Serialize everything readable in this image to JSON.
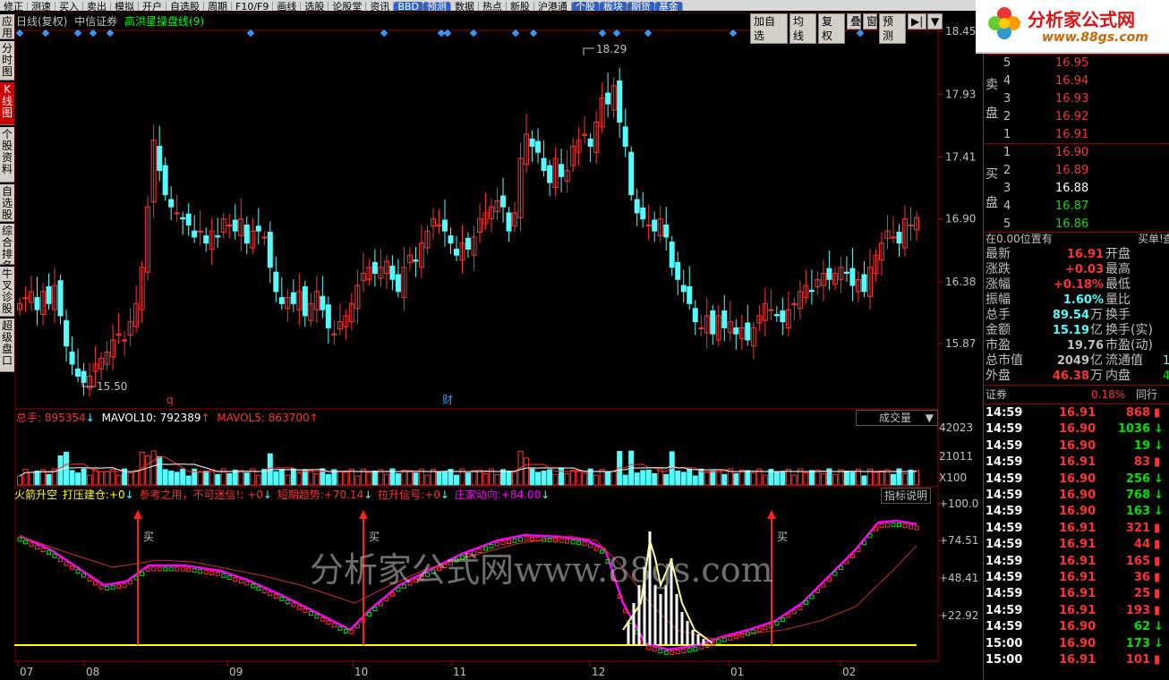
{
  "toolbar": {
    "items": [
      "修正",
      "测速",
      "买入",
      "卖出",
      "模拟",
      "开户",
      "自选股",
      "周期",
      "F10/F9",
      "画线",
      "选股",
      "论股堂",
      "资讯",
      "BBD",
      "预测",
      "数据",
      "热点",
      "新股",
      "沪港通",
      "个股",
      "板块",
      "期货",
      "基金"
    ]
  },
  "logo": {
    "name": "分析家公式网",
    "url": "www.88gs.com"
  },
  "left_tabs": [
    {
      "label": "应用"
    },
    {
      "label": "分时图"
    },
    {
      "label": "K线图"
    },
    {
      "label": "个股资料"
    },
    {
      "label": "自选股"
    },
    {
      "label": "综合排名"
    },
    {
      "label": "牛叉诊股"
    },
    {
      "label": "超级盘口"
    }
  ],
  "chart_header": {
    "period": "日线(复权)",
    "stock": "中信证券",
    "indicator": "高洪星操盘线(9)"
  },
  "chart_buttons": [
    "加自选",
    "均线",
    "复权",
    "叠",
    "窗",
    "预测"
  ],
  "price_axis": [
    "18.45",
    "17.93",
    "17.41",
    "16.90",
    "16.38",
    "15.87"
  ],
  "price_annotations": {
    "high": "18.29",
    "low": "15.50",
    "q_mark": "q",
    "cai_mark": "财"
  },
  "volume_header": {
    "total_label": "总手:",
    "total_value": "895354",
    "mavol10_label": "MAVOL10:",
    "mavol10_value": "792389",
    "mavol5_label": "MAVOL5:",
    "mavol5_value": "863700",
    "dropdown": "成交量"
  },
  "volume_axis": [
    "42023",
    "21011",
    "X100"
  ],
  "indicator_header": {
    "name": "火箭升空",
    "t1": "打压建仓:",
    "v1": "+0",
    "t2": "参考之用，不可迷信!",
    "v2": "+0",
    "t3": "短期趋势:",
    "v3": "+70.14",
    "t4": "拉升信号:",
    "v4": "+0",
    "t5": "庄家动向:",
    "v5": "+84.00",
    "button": "指标说明"
  },
  "indicator_axis": [
    "+100.0",
    "+74.51",
    "+48.41",
    "+22.92"
  ],
  "buy_label": "买",
  "watermark": "分析家公式网www.88gs.com",
  "date_axis": [
    "07",
    "08",
    "09",
    "10",
    "11",
    "12",
    "01",
    "02"
  ],
  "colors": {
    "up": "#ff3232",
    "down": "#54fcfc",
    "magenta": "#ff00ff",
    "yellow": "#ffff00",
    "green": "#00e000"
  },
  "order_book": {
    "sell_label": [
      "卖",
      "盘"
    ],
    "buy_label": [
      "买",
      "盘"
    ],
    "sell": [
      {
        "level": "5",
        "price": "16.95"
      },
      {
        "level": "4",
        "price": "16.94"
      },
      {
        "level": "3",
        "price": "16.93"
      },
      {
        "level": "2",
        "price": "16.92"
      },
      {
        "level": "1",
        "price": "16.91"
      }
    ],
    "buy": [
      {
        "level": "1",
        "price": "16.90"
      },
      {
        "level": "2",
        "price": "16.89"
      },
      {
        "level": "3",
        "price": "16.88"
      },
      {
        "level": "4",
        "price": "16.87"
      },
      {
        "level": "5",
        "price": "16.86"
      }
    ],
    "position_text": "在0.00位置有",
    "buy_single": "买单!",
    "buy_single_extra": "查"
  },
  "quotes": [
    {
      "l": "最新",
      "v": "16.91",
      "r": "开盘"
    },
    {
      "l": "涨跌",
      "v": "+0.03",
      "r": "最高"
    },
    {
      "l": "涨幅",
      "v": "+0.18%",
      "r": "最低"
    },
    {
      "l": "振幅",
      "v": "1.60%",
      "r": "量比"
    },
    {
      "l": "总手",
      "v": "89.54",
      "u": "万",
      "r": "换手"
    },
    {
      "l": "金额",
      "v": "15.19",
      "u": "亿",
      "r": "换手(实)"
    },
    {
      "l": "市盈",
      "v": "19.76",
      "r": "市盈(动)"
    },
    {
      "l": "总市值",
      "v": "2049",
      "u": "亿",
      "r": "流通值",
      "rv": "1"
    },
    {
      "l": "外盘",
      "v": "46.38",
      "u": "万",
      "r": "内盘",
      "rv": "4"
    }
  ],
  "sector": {
    "name": "证券",
    "pct": "0.18%",
    "label": "同行"
  },
  "ticks": [
    {
      "t": "14:59",
      "p": "16.91",
      "v": "868",
      "d": "up"
    },
    {
      "t": "14:59",
      "p": "16.90",
      "v": "1036",
      "d": "down"
    },
    {
      "t": "14:59",
      "p": "16.90",
      "v": "19",
      "d": "down"
    },
    {
      "t": "14:59",
      "p": "16.91",
      "v": "83",
      "d": "up"
    },
    {
      "t": "14:59",
      "p": "16.90",
      "v": "256",
      "d": "down"
    },
    {
      "t": "14:59",
      "p": "16.90",
      "v": "768",
      "d": "down"
    },
    {
      "t": "14:59",
      "p": "16.90",
      "v": "163",
      "d": "down"
    },
    {
      "t": "14:59",
      "p": "16.91",
      "v": "321",
      "d": "up"
    },
    {
      "t": "14:59",
      "p": "16.91",
      "v": "44",
      "d": "up"
    },
    {
      "t": "14:59",
      "p": "16.91",
      "v": "165",
      "d": "up"
    },
    {
      "t": "14:59",
      "p": "16.91",
      "v": "36",
      "d": "up"
    },
    {
      "t": "14:59",
      "p": "16.91",
      "v": "25",
      "d": "up"
    },
    {
      "t": "14:59",
      "p": "16.91",
      "v": "193",
      "d": "up"
    },
    {
      "t": "14:59",
      "p": "16.90",
      "v": "62",
      "d": "down"
    },
    {
      "t": "15:00",
      "p": "16.90",
      "v": "173",
      "d": "down"
    },
    {
      "t": "15:00",
      "p": "16.91",
      "v": "101",
      "d": "up"
    }
  ]
}
